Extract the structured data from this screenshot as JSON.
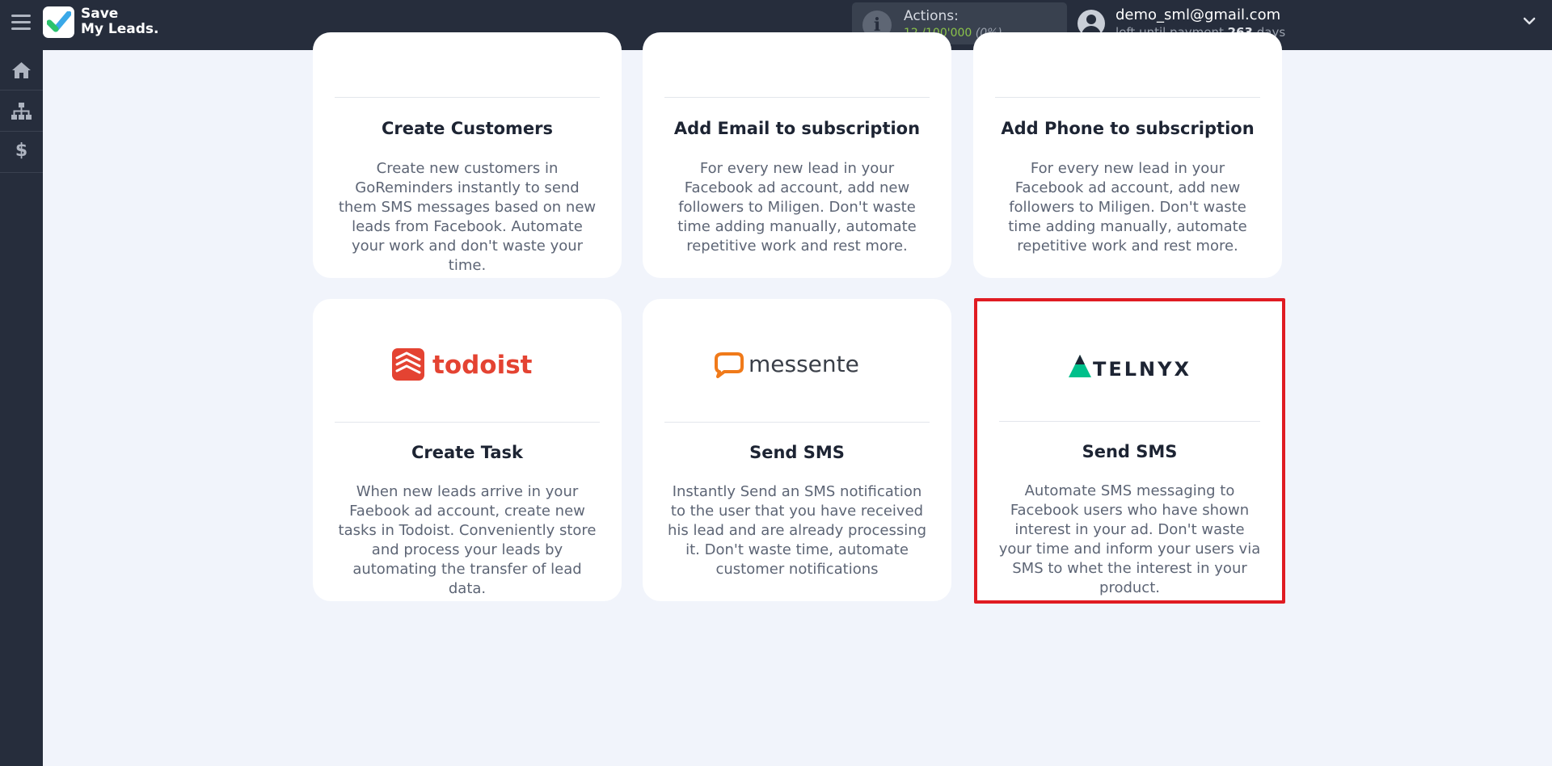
{
  "app": {
    "logo_line1": "Save",
    "logo_line2": "My Leads",
    "logo_dot": "."
  },
  "actions": {
    "label": "Actions:",
    "used": "12",
    "separator": " /",
    "limit": "100'000",
    "percent": "(0%)"
  },
  "user": {
    "email": "demo_sml@gmail.com",
    "sub_prefix": "left until payment ",
    "days": "263",
    "sub_suffix": " days"
  },
  "sidebar": {
    "items": [
      "home-icon",
      "sitemap-icon",
      "dollar-icon"
    ],
    "dollar_glyph": "$"
  },
  "cards_top": [
    {
      "title": "Create Customers",
      "desc": "Create new customers in GoReminders instantly to send them SMS messages based on new leads from Facebook. Automate your work and don't waste your time."
    },
    {
      "title": "Add Email to subscription",
      "desc": "For every new lead in your Facebook ad account, add new followers to Miligen. Don't waste time adding manually, automate repetitive work and rest more."
    },
    {
      "title": "Add Phone to subscription",
      "desc": "For every new lead in your Facebook ad account, add new followers to Miligen. Don't waste time adding manually, automate repetitive work and rest more."
    }
  ],
  "cards_bottom": [
    {
      "logo": "todoist",
      "title": "Create Task",
      "desc": "When new leads arrive in your Faebook ad account, create new tasks in Todoist. Conveniently store and process your leads by automating the transfer of lead data."
    },
    {
      "logo": "messente",
      "title": "Send SMS",
      "desc": "Instantly Send an SMS notification to the user that you have received his lead and are already processing it. Don't waste time, automate customer notifications"
    },
    {
      "logo": "TELNYX",
      "title": "Send SMS",
      "desc": "Automate SMS messaging to Facebook users who have shown interest in your ad. Don't waste your time and inform your users via SMS to whet the interest in your product."
    }
  ],
  "colors": {
    "highlight": "#e01b22",
    "todoist": "#e44332",
    "messente": "#f07a1a",
    "telnyx": "#00c08b"
  }
}
